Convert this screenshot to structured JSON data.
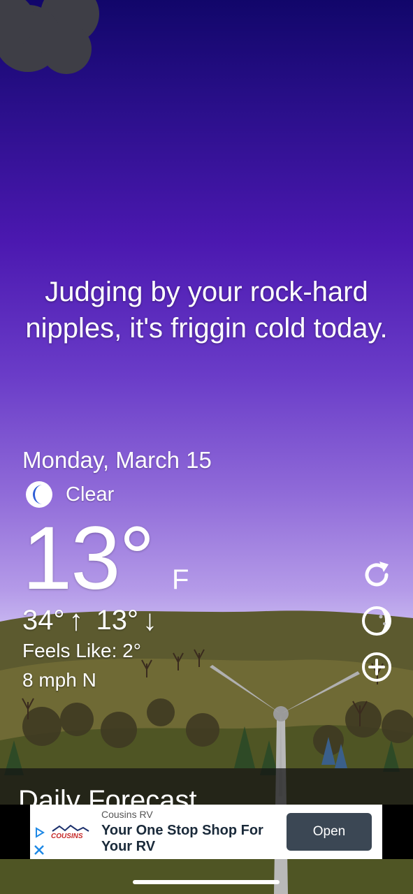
{
  "tagline": "Judging by your rock-hard nipples, it's friggin cold today.",
  "weather": {
    "date": "Monday, March 15",
    "condition": "Clear",
    "condition_icon": "moon-icon",
    "temperature": "13°",
    "unit": "F",
    "high": "34°",
    "high_arrow": "↑",
    "low": "13°",
    "low_arrow": "↓",
    "feels_like": "Feels Like: 2°",
    "wind": "8 mph N"
  },
  "side_actions": [
    "refresh-icon",
    "moon-phase-icon",
    "add-icon"
  ],
  "forecast": {
    "label": "Daily Forecast"
  },
  "ad": {
    "advertiser": "Cousins RV",
    "headline": "Your One Stop Shop For Your RV",
    "cta": "Open",
    "logo_text": "COUSINS"
  },
  "colors": {
    "sky_top": "#11066a",
    "sky_bottom": "#c7b6f0",
    "moon": "#2f5fd6",
    "ad_button": "#3b4754"
  }
}
